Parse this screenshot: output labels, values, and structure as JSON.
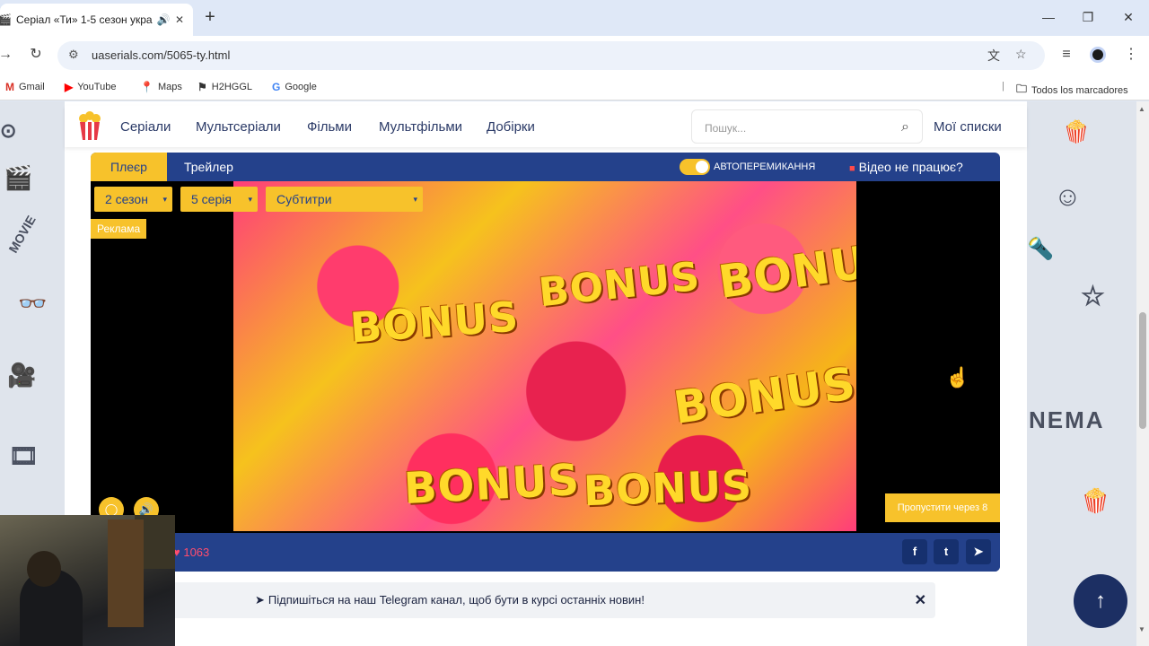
{
  "browser": {
    "tab_title": "Серіал «Ти» 1-5 сезон укра",
    "url": "uaserials.com/5065-ty.html",
    "bookmarks": [
      "Gmail",
      "YouTube",
      "Maps",
      "H2HGGL",
      "Google"
    ],
    "all_bookmarks": "Todos los marcadores"
  },
  "site": {
    "nav": [
      "Серіали",
      "Мультсеріали",
      "Фільми",
      "Мультфільми",
      "Добірки"
    ],
    "search_placeholder": "Пошук...",
    "my_lists": "Мої списки"
  },
  "player": {
    "tab_player": "Плеєр",
    "tab_trailer": "Трейлер",
    "autoplay_label": "АВТОПЕРЕМИКАННЯ",
    "autoplay_on": true,
    "not_working": "Відео не працює?",
    "season": "2 сезон",
    "episode": "5 серія",
    "subtitles": "Субтитри",
    "ad_badge": "Реклама",
    "ad_text": "BONUS",
    "skip": "Пропустити через 8",
    "likes": "1063"
  },
  "telegram_bar": {
    "message": "Підпишіться на наш Telegram канал, щоб бути в курсі останніх новин!"
  },
  "colors": {
    "accent": "#f7c22b",
    "player_bg": "#24418b",
    "nav_text": "#2b3a67"
  }
}
